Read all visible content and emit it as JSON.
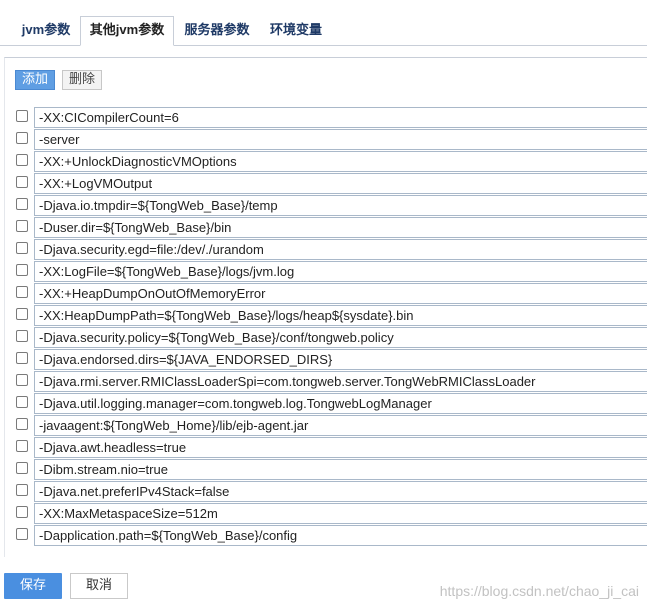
{
  "tabs": [
    {
      "label": "jvm参数"
    },
    {
      "label": "其他jvm参数"
    },
    {
      "label": "服务器参数"
    },
    {
      "label": "环境变量"
    }
  ],
  "active_tab": "其他jvm参数",
  "toolbar": {
    "add_label": "添加",
    "delete_label": "删除"
  },
  "params": [
    "-XX:CICompilerCount=6",
    "-server",
    "-XX:+UnlockDiagnosticVMOptions",
    "-XX:+LogVMOutput",
    "-Djava.io.tmpdir=${TongWeb_Base}/temp",
    "-Duser.dir=${TongWeb_Base}/bin",
    "-Djava.security.egd=file:/dev/./urandom",
    "-XX:LogFile=${TongWeb_Base}/logs/jvm.log",
    "-XX:+HeapDumpOnOutOfMemoryError",
    "-XX:HeapDumpPath=${TongWeb_Base}/logs/heap${sysdate}.bin",
    "-Djava.security.policy=${TongWeb_Base}/conf/tongweb.policy",
    "-Djava.endorsed.dirs=${JAVA_ENDORSED_DIRS}",
    "-Djava.rmi.server.RMIClassLoaderSpi=com.tongweb.server.TongWebRMIClassLoader",
    "-Djava.util.logging.manager=com.tongweb.log.TongwebLogManager",
    "-javaagent:${TongWeb_Home}/lib/ejb-agent.jar",
    "-Djava.awt.headless=true",
    "-Dibm.stream.nio=true",
    "-Djava.net.preferIPv4Stack=false",
    "-XX:MaxMetaspaceSize=512m",
    "-Dapplication.path=${TongWeb_Base}/config"
  ],
  "footer": {
    "save_label": "保存",
    "cancel_label": "取消"
  },
  "watermark": "https://blog.csdn.net/chao_ji_cai",
  "colors": {
    "primary": "#4a8fe0",
    "tab_text": "#1f3a66",
    "border": "#a9b8c9"
  }
}
